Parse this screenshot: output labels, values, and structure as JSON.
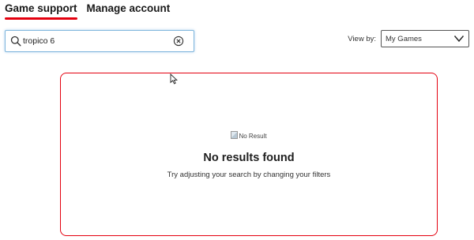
{
  "tabs": [
    {
      "label": "Game support",
      "active": true
    },
    {
      "label": "Manage account",
      "active": false
    }
  ],
  "search": {
    "value": "tropico 6",
    "icon": "search-icon",
    "clear_icon": "clear-circle-x-icon"
  },
  "view_by": {
    "label": "View by:",
    "selected": "My Games"
  },
  "results": {
    "image_alt": "No Result",
    "title": "No results found",
    "message": "Try adjusting your search by changing your filters"
  },
  "colors": {
    "accent": "#e4000f",
    "search_focus": "#7fb6dd",
    "text": "#1a1a1a"
  }
}
